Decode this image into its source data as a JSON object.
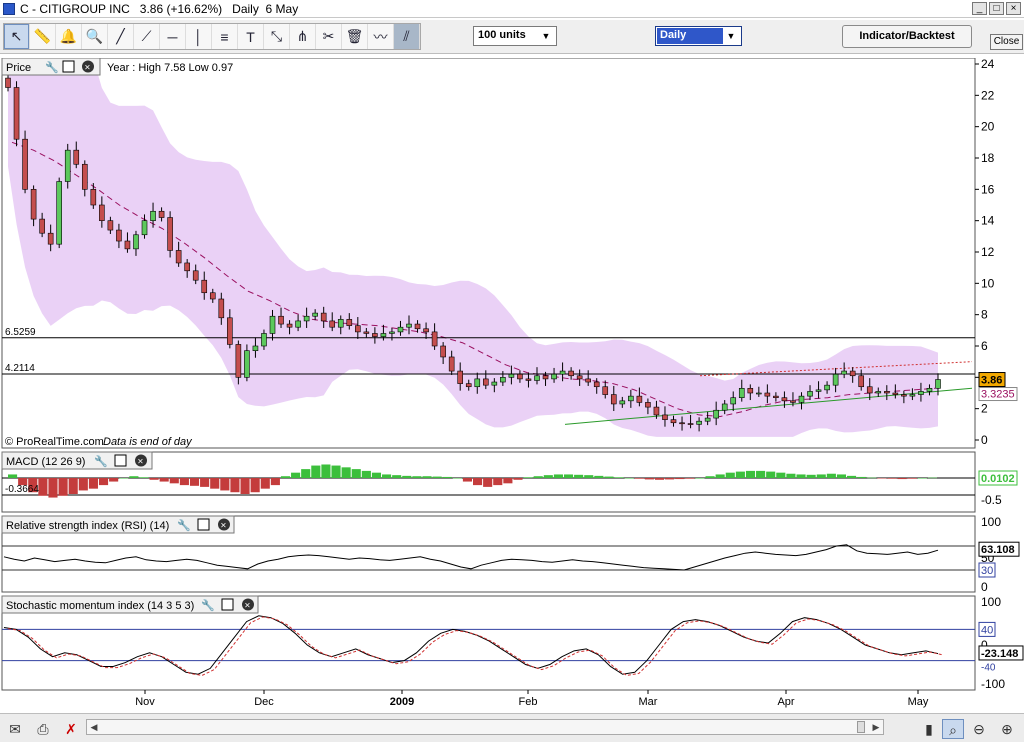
{
  "window": {
    "title": "C - CITIGROUP INC   3.86 (+16.62%)   Daily  6 May",
    "minimize": "_",
    "maximize": "□",
    "close": "×"
  },
  "toolbar": {
    "units_select": "100 units",
    "period_select": "Daily",
    "indicator_button": "Indicator/Backtest",
    "close_button": "Close",
    "tools": [
      "pointer-icon",
      "ruler-icon",
      "alarm-bell-icon",
      "zoom-icon",
      "line-icon",
      "trend-line-icon",
      "horizontal-line-icon",
      "vertical-line-icon",
      "fibonacci-icon",
      "text-icon",
      "arrows-icon",
      "pitchfork-icon",
      "tools-icon",
      "trash-icon",
      "chart-type-icon",
      "channel-icon"
    ]
  },
  "chart_data": {
    "type": "candlestick",
    "price_panel": {
      "title": "Price",
      "info": "Year : High 7.58 Low 0.97",
      "watermark": "© ProRealTime.com",
      "watermark2": "Data is end of day",
      "yticks": [
        "24",
        "22",
        "20",
        "18",
        "16",
        "14",
        "12",
        "10",
        "8",
        "6",
        "4",
        "2",
        "0"
      ],
      "ylim": [
        0,
        24
      ],
      "hlines": [
        {
          "label": "6.5259",
          "value": 6.5259
        },
        {
          "label": "4.2114",
          "value": 4.2114
        }
      ],
      "last_price": "3.86",
      "ma_value": "3.3235",
      "up_color": "#5cc85c",
      "down_color": "#c44e4e",
      "band_color": "#e6c9f4",
      "closes": [
        22.5,
        19.2,
        16.0,
        14.1,
        13.2,
        12.5,
        16.5,
        18.5,
        17.6,
        16.0,
        15.0,
        14.0,
        13.4,
        12.7,
        12.2,
        13.1,
        14.0,
        14.6,
        14.2,
        12.1,
        11.3,
        10.8,
        10.2,
        9.4,
        9.0,
        7.8,
        6.1,
        4.0,
        5.7,
        6.0,
        6.8,
        7.9,
        7.4,
        7.2,
        7.6,
        7.9,
        8.1,
        7.6,
        7.2,
        7.7,
        7.3,
        6.9,
        6.8,
        6.6,
        6.8,
        6.9,
        7.2,
        7.4,
        7.1,
        6.9,
        6.0,
        5.3,
        4.4,
        3.6,
        3.4,
        3.9,
        3.5,
        3.7,
        4.0,
        4.2,
        3.9,
        3.8,
        4.1,
        3.9,
        4.2,
        4.4,
        4.1,
        3.9,
        3.7,
        3.4,
        2.9,
        2.3,
        2.5,
        2.8,
        2.4,
        2.1,
        1.6,
        1.3,
        1.1,
        1.05,
        1.0,
        1.2,
        1.4,
        1.9,
        2.3,
        2.7,
        3.3,
        3.0,
        3.0,
        2.8,
        2.7,
        2.5,
        2.4,
        2.8,
        3.1,
        3.2,
        3.5,
        4.2,
        4.4,
        4.1,
        3.4,
        3.0,
        3.1,
        3.0,
        2.9,
        2.8,
        2.9,
        3.1,
        3.3,
        3.86
      ],
      "ma_dashed": [
        19,
        18.5,
        17.8,
        16.9,
        16.0,
        15.0,
        14.2,
        13.5,
        12.6,
        11.6,
        10.5,
        9.5,
        8.9,
        8.2,
        7.7,
        7.5,
        7.4,
        7.3,
        7.1,
        6.9,
        6.6,
        6.2,
        5.5,
        4.8,
        4.3,
        4.1,
        3.9,
        3.8,
        3.6,
        3.2,
        2.6,
        2.0,
        1.6,
        1.5,
        1.8,
        2.2,
        2.5,
        2.6,
        2.7,
        2.9,
        3.0,
        3.1,
        3.2,
        3.3
      ]
    },
    "macd_panel": {
      "title": "MACD (12 26 9)",
      "yticks": [
        "0",
        "-0.5"
      ],
      "left_label": "-0.3664",
      "value": "0.0102",
      "bars": [
        0.1,
        -0.2,
        -0.4,
        -0.5,
        -0.55,
        -0.5,
        -0.45,
        -0.35,
        -0.3,
        -0.2,
        -0.1,
        0,
        0.05,
        0.02,
        -0.05,
        -0.1,
        -0.15,
        -0.2,
        -0.22,
        -0.25,
        -0.3,
        -0.35,
        -0.4,
        -0.45,
        -0.4,
        -0.3,
        -0.2,
        0.05,
        0.15,
        0.25,
        0.35,
        0.38,
        0.35,
        0.3,
        0.25,
        0.2,
        0.15,
        0.1,
        0.08,
        0.06,
        0.05,
        0.05,
        0.04,
        0.03,
        0,
        -0.1,
        -0.2,
        -0.25,
        -0.2,
        -0.15,
        -0.05,
        0.02,
        0.05,
        0.08,
        0.1,
        0.1,
        0.09,
        0.08,
        0.06,
        0.04,
        0.02,
        0,
        -0.02,
        -0.04,
        -0.05,
        -0.04,
        -0.03,
        -0.02,
        0,
        0.05,
        0.1,
        0.15,
        0.18,
        0.2,
        0.2,
        0.18,
        0.15,
        0.12,
        0.1,
        0.09,
        0.1,
        0.12,
        0.1,
        0.06,
        0.03,
        0.01,
        -0.01,
        -0.02,
        -0.03,
        -0.02,
        0,
        0.01
      ]
    },
    "rsi_panel": {
      "title": "Relative strength index (RSI) (14)",
      "yticks": [
        "100",
        "50",
        "0"
      ],
      "upper": "70",
      "lower": "30",
      "value": "63.108",
      "lower_label": "30",
      "line": [
        52,
        48,
        45,
        50,
        47,
        44,
        46,
        48,
        45,
        43,
        42,
        46,
        50,
        52,
        47,
        45,
        44,
        46,
        48,
        46,
        42,
        38,
        36,
        34,
        32,
        40,
        45,
        48,
        52,
        54,
        55,
        54,
        52,
        50,
        48,
        50,
        49,
        47,
        46,
        48,
        50,
        52,
        48,
        45,
        40,
        35,
        32,
        38,
        42,
        46,
        48,
        47,
        46,
        44,
        43,
        45,
        47,
        45,
        44,
        42,
        40,
        38,
        36,
        34,
        33,
        32,
        31,
        30,
        35,
        40,
        45,
        50,
        54,
        58,
        60,
        58,
        56,
        55,
        54,
        56,
        60,
        64,
        70,
        72,
        62,
        58,
        57,
        56,
        58,
        60,
        56,
        58,
        63
      ]
    },
    "stoch_panel": {
      "title": "Stochastic momentum index (14 3 5 3)",
      "yticks": [
        "100",
        "0",
        "-100"
      ],
      "upper": "40",
      "value": "-23.148",
      "lower_label": "-40",
      "line": [
        45,
        40,
        20,
        -10,
        -30,
        -20,
        -25,
        -40,
        -55,
        -55,
        -45,
        -30,
        -20,
        -30,
        -50,
        -70,
        -75,
        -60,
        -20,
        20,
        60,
        75,
        70,
        55,
        30,
        0,
        -20,
        -30,
        -20,
        -10,
        -25,
        -35,
        -45,
        -40,
        -20,
        10,
        30,
        40,
        35,
        25,
        10,
        -10,
        -30,
        -50,
        -60,
        -50,
        -30,
        -15,
        -10,
        -25,
        -55,
        -75,
        -70,
        -40,
        0,
        40,
        60,
        65,
        60,
        50,
        35,
        20,
        10,
        5,
        30,
        60,
        70,
        65,
        55,
        40,
        20,
        0,
        -10,
        -20,
        -25,
        -20,
        -15,
        -22
      ]
    },
    "x_labels": [
      "Nov",
      "Dec",
      "2009",
      "Feb",
      "Mar",
      "Apr",
      "May"
    ]
  }
}
